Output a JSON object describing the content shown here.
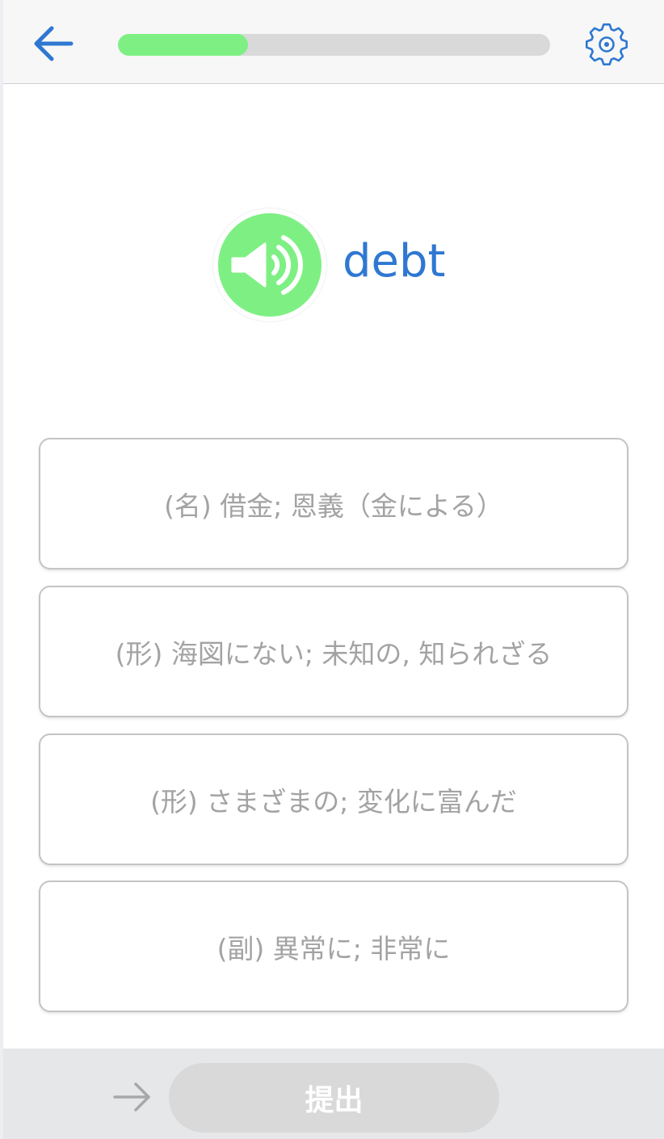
{
  "header": {
    "back_icon": "arrow-left-icon",
    "settings_icon": "gear-icon",
    "progress": 0.3,
    "progress_color": "#7ef083",
    "accent_color": "#2e78d2"
  },
  "question": {
    "audio_icon": "speaker-icon",
    "word": "debt"
  },
  "options": [
    {
      "label": "(名) 借金; 恩義（金による）"
    },
    {
      "label": "(形) 海図にない; 未知の, 知られざる"
    },
    {
      "label": "(形) さまざまの; 変化に富んだ"
    },
    {
      "label": "(副) 異常に; 非常に"
    }
  ],
  "footer": {
    "skip_icon": "arrow-right-icon",
    "submit_label": "提出"
  }
}
